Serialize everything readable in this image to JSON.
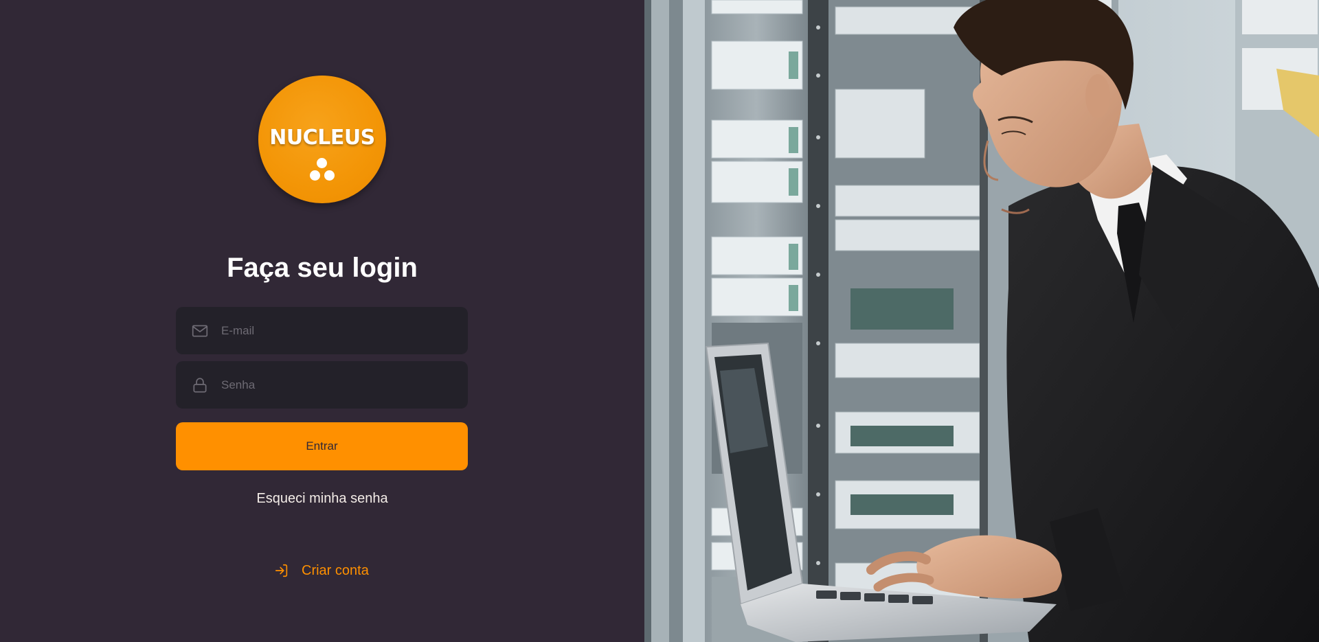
{
  "logo": {
    "text": "NUCLEUS",
    "background": "#f39506",
    "alt": "nucleus-logo"
  },
  "login": {
    "title": "Faça seu login",
    "email": {
      "placeholder": "E-mail",
      "value": "",
      "icon": "mail-icon"
    },
    "password": {
      "placeholder": "Senha",
      "value": "",
      "icon": "lock-icon"
    },
    "submit_label": "Entrar",
    "forgot_label": "Esqueci minha senha",
    "create_label": "Criar conta",
    "create_icon": "log-in-icon"
  },
  "colors": {
    "background": "#312836",
    "input_background": "#232129",
    "accent": "#ff9000",
    "placeholder": "#6e6b74",
    "text": "#ffffff"
  },
  "hero_image": {
    "subject": "background-photo"
  }
}
